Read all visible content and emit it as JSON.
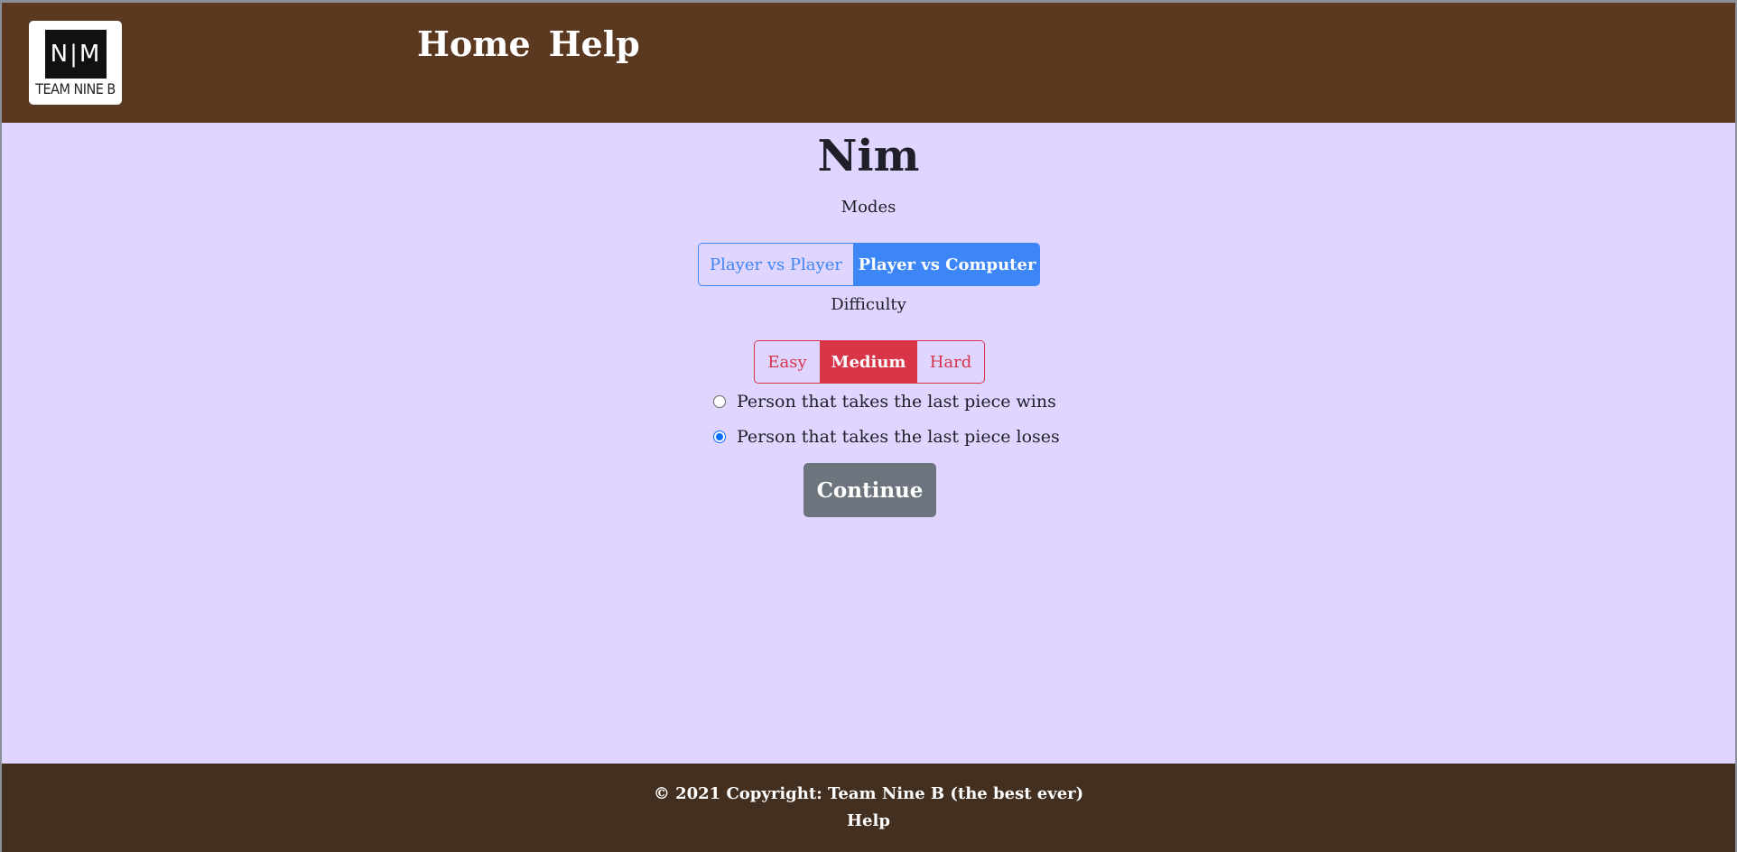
{
  "header": {
    "logo": {
      "mark": "N|M",
      "text": "TEAM NINE B"
    },
    "nav": [
      {
        "label": "Home"
      },
      {
        "label": "Help"
      }
    ]
  },
  "main": {
    "title": "Nim",
    "modes_label": "Modes",
    "modes": [
      {
        "label": "Player vs Player",
        "selected": false
      },
      {
        "label": "Player vs Computer",
        "selected": true
      }
    ],
    "difficulty_label": "Difficulty",
    "difficulties": [
      {
        "label": "Easy",
        "selected": false
      },
      {
        "label": "Medium",
        "selected": true
      },
      {
        "label": "Hard",
        "selected": false
      }
    ],
    "rules": [
      {
        "label": "Person that takes the last piece wins",
        "checked": false
      },
      {
        "label": "Person that takes the last piece loses",
        "checked": true
      }
    ],
    "continue_label": "Continue"
  },
  "footer": {
    "copyright": "© 2021 Copyright: Team Nine B (the best ever)",
    "help_link": "Help"
  },
  "colors": {
    "header_bg": "#5a3920",
    "page_bg": "#e0d5ff",
    "footer_bg": "#432f1f",
    "mode_accent": "#3c86f7",
    "difficulty_accent": "#d93549",
    "continue_bg": "#6c757d"
  }
}
